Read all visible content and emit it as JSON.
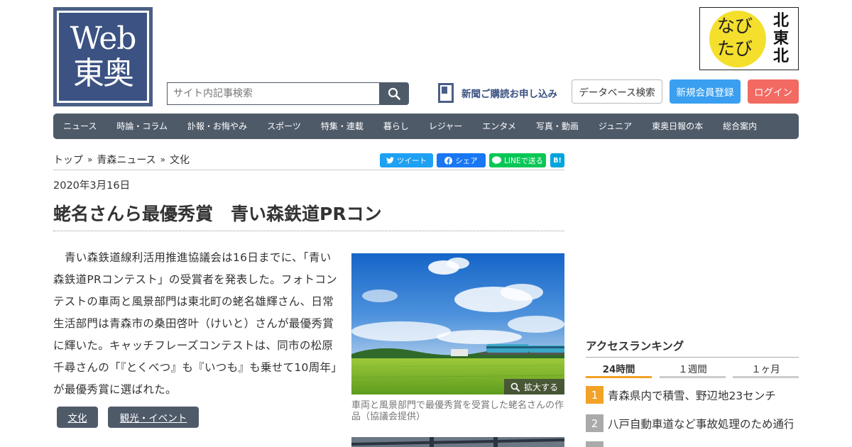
{
  "logo": {
    "line1": "Web",
    "line2": "東奥"
  },
  "search": {
    "placeholder": "サイト内記事検索",
    "value": ""
  },
  "header": {
    "subscribe": "新聞ご購読お申し込み",
    "database": "データベース検索",
    "register": "新規会員登録",
    "login": "ログイン"
  },
  "banner": {
    "line1": "なび",
    "line2": "たび",
    "vertical": [
      "北",
      "東",
      "北"
    ]
  },
  "nav": [
    "ニュース",
    "時論・コラム",
    "訃報・お悔やみ",
    "スポーツ",
    "特集・連載",
    "暮らし",
    "レジャー",
    "エンタメ",
    "写真・動画",
    "ジュニア",
    "東奥日報の本",
    "総合案内"
  ],
  "breadcrumb": [
    "トップ",
    "青森ニュース",
    "文化"
  ],
  "breadcrumb_sep": "»",
  "share": {
    "tweet": "ツイート",
    "facebook": "シェア",
    "line": "LINEで送る",
    "hatena": "B!"
  },
  "article": {
    "date": "2020年3月16日",
    "title": "蛯名さんら最優秀賞　青い森鉄道PRコン",
    "body": "青い森鉄道線利活用推進協議会は16日までに、「青い森鉄道PRコンテスト」の受賞者を発表した。フォトコンテストの車両と風景部門は東北町の蛯名雄輝さん、日常生活部門は青森市の桑田啓叶（けいと）さんが最優秀賞に輝いた。キャッチフレーズコンテストは、同市の松原千尋さんの「『とくべつ』も『いつも』も乗せて10周年」が最優秀賞に選ばれた。",
    "tags": [
      "文化",
      "観光・イベント"
    ],
    "photo_zoom": "拡大する",
    "photo_caption": "車両と風景部門で最優秀賞を受賞した蛯名さんの作品（協議会提供）"
  },
  "ranking": {
    "title": "アクセスランキング",
    "tabs": [
      "24時間",
      "１週間",
      "１ヶ月"
    ],
    "active_tab": "24時間",
    "items": [
      {
        "rank": "1",
        "text": "青森県内で積雪、野辺地23センチ"
      },
      {
        "rank": "2",
        "text": "八戸自動車道など事故処理のため通行止め"
      }
    ]
  },
  "colors": {
    "brand": "#4a5f86",
    "nav": "#4f5a69",
    "register": "#3a9ff0",
    "login": "#f26a62",
    "rank_first": "#f2a227",
    "rank_other": "#aaaaaa"
  }
}
